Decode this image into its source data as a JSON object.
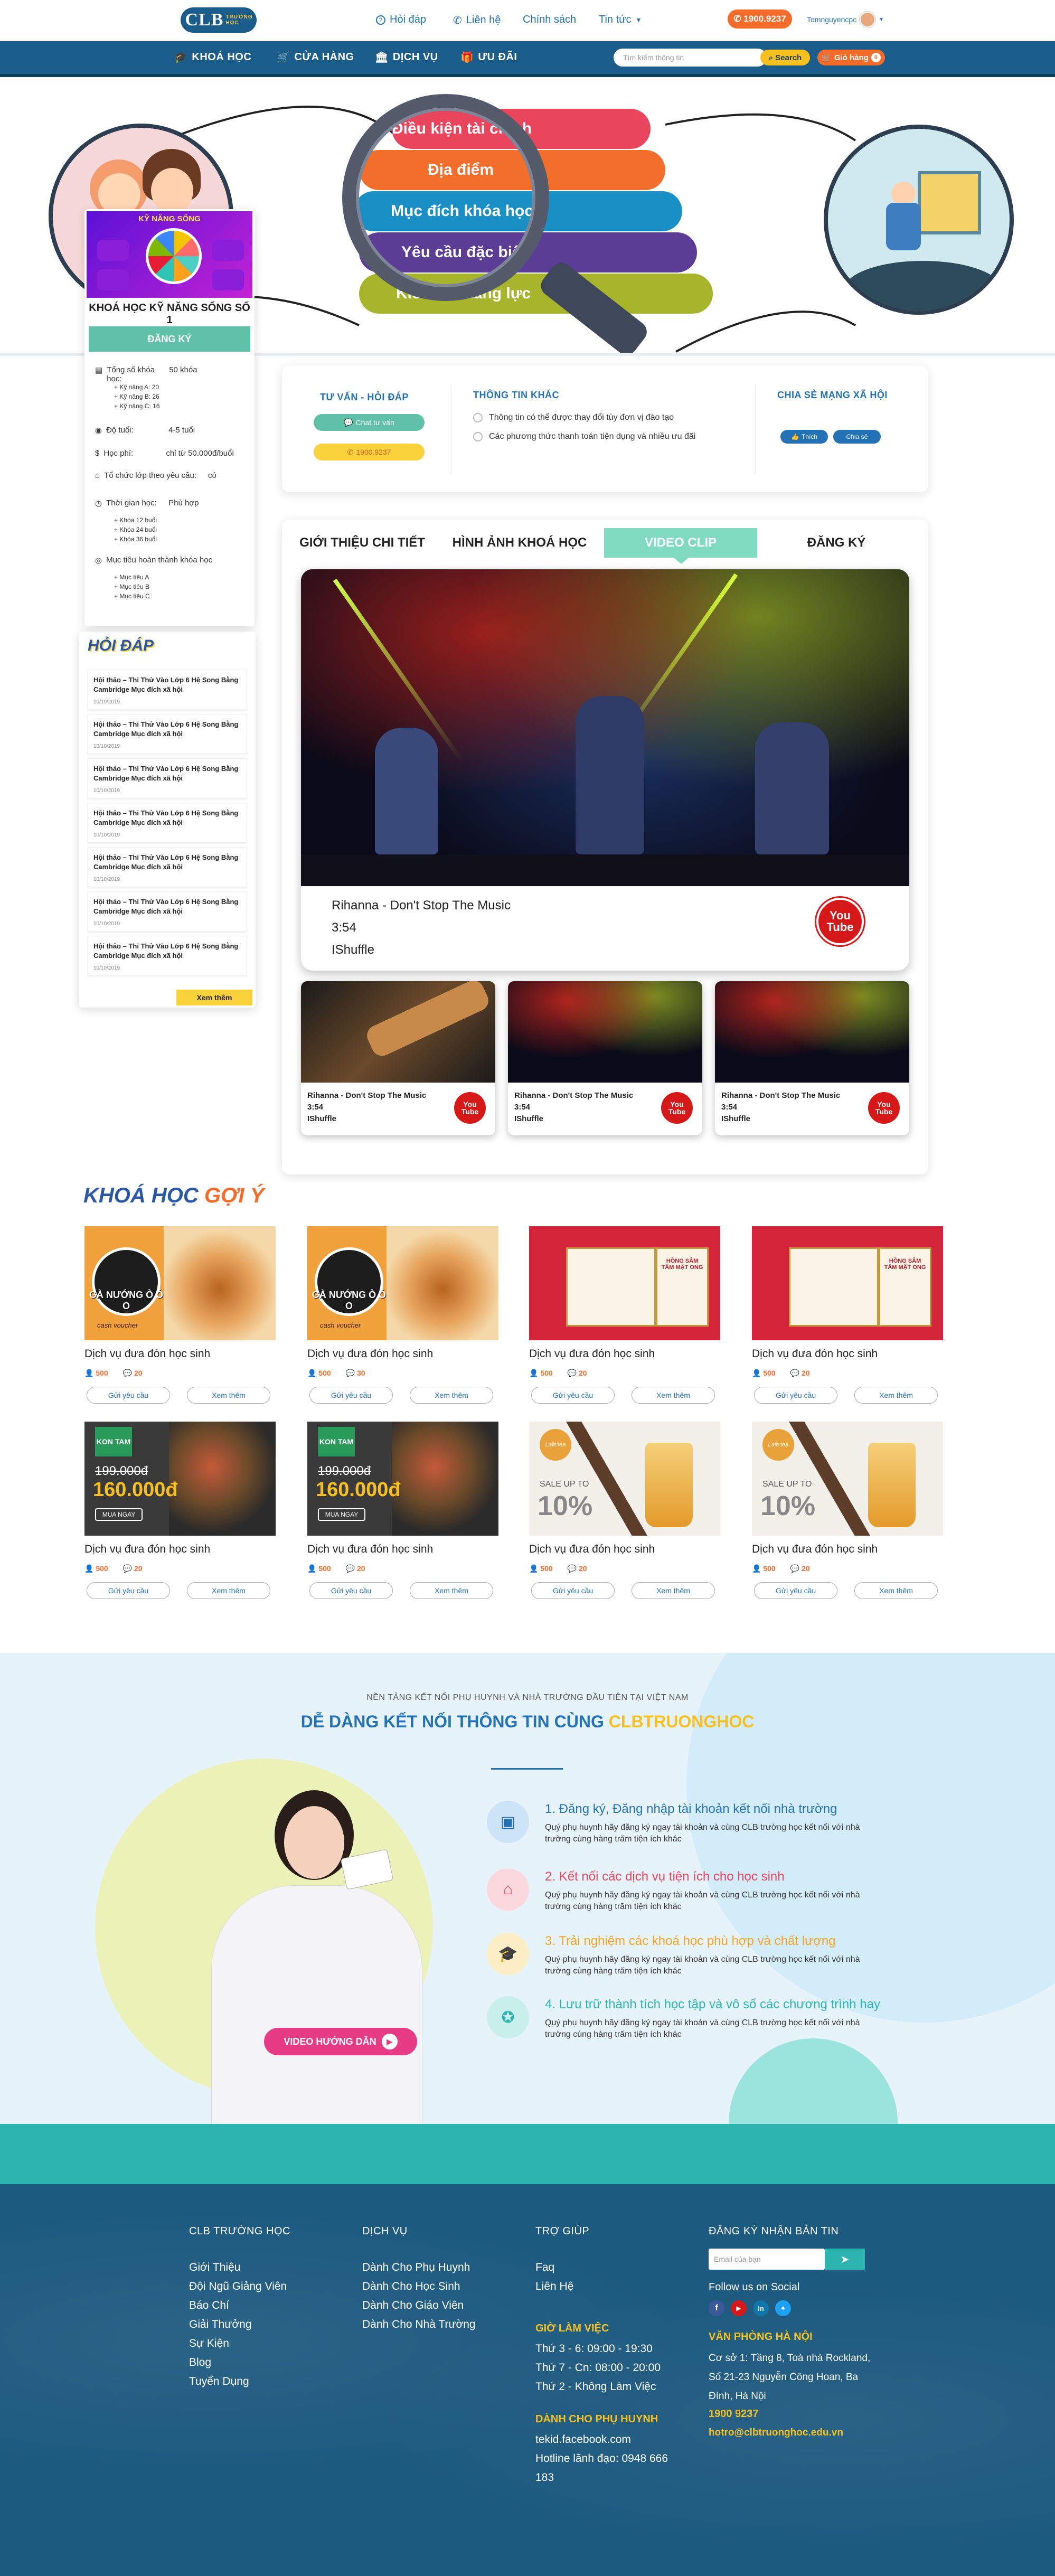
{
  "header": {
    "logo_text": "CLB",
    "logo_sub": "TRƯỜNG HỌC",
    "nav": [
      "Hỏi đáp",
      "Liên hệ",
      "Chính sách",
      "Tin tức"
    ],
    "hotline": "1900.9237",
    "username": "Tomnguyencpc"
  },
  "mainnav": {
    "items": [
      "KHOÁ HỌC",
      "CỬA HÀNG",
      "DỊCH VỤ",
      "ƯU ĐÃI"
    ],
    "search_placeholder": "Tìm kiếm thông tin",
    "search_button": "Search",
    "cart_button": "Giỏ hàng",
    "cart_count": "0"
  },
  "hero": {
    "bands": [
      "Điều kiện tài chính",
      "Địa điểm",
      "Mục đích khóa học",
      "Yêu cầu đặc biệt",
      "Kiểm tra năng lực"
    ],
    "colors": {
      "band1": "#e9455c",
      "band2": "#f36d2b",
      "band3": "#1a8fc6",
      "band4": "#5b3d96",
      "band5": "#a6b52c"
    }
  },
  "course": {
    "image_title": "KỸ NĂNG SỐNG",
    "title": "KHOÁ HỌC KỸ NĂNG SỐNG SỐ 1",
    "register": "ĐĂNG KÝ",
    "total_label": "Tổng số khóa học:",
    "total_value": "50 khóa",
    "total_sub": [
      "+ Kỹ năng A: 20",
      "+ Kỹ năng B: 26",
      "+ Kỹ năng C: 16"
    ],
    "age_label": "Độ tuổi:",
    "age_value": "4-5 tuổi",
    "fee_label": "Học phí:",
    "fee_value": "chỉ từ 50.000đ/buổi",
    "custom_label": "Tổ chức lớp theo yêu cầu:",
    "custom_value": "có",
    "time_label": "Thời gian học:",
    "time_value": "Phù hợp",
    "time_sub": [
      "+ Khóa 12 buổi",
      "+ Khóa 24 buổi",
      "+ Khóa 36 buổi"
    ],
    "goal_label": "Mục tiêu hoàn thành khóa học",
    "goal_sub": [
      "+ Mục tiêu A",
      "+ Mục tiêu B",
      "+ Mục tiêu C"
    ]
  },
  "qa": {
    "title": "HỎI ĐÁP",
    "items": [
      {
        "title": "Hội thảo – Thi Thử Vào Lớp 6 Hệ Song Bằng Cambridge Mục đích xã hội",
        "date": "10/10/2019"
      },
      {
        "title": "Hội thảo – Thi Thử Vào Lớp 6 Hệ Song Bằng Cambridge Mục đích xã hội",
        "date": "10/10/2019"
      },
      {
        "title": "Hội thảo – Thi Thử Vào Lớp 6 Hệ Song Bằng Cambridge Mục đích xã hội",
        "date": "10/10/2019"
      },
      {
        "title": "Hội thảo – Thi Thử Vào Lớp 6 Hệ Song Bằng Cambridge Mục đích xã hội",
        "date": "10/10/2019"
      },
      {
        "title": "Hội thảo – Thi Thử Vào Lớp 6 Hệ Song Bằng Cambridge Mục đích xã hội",
        "date": "10/10/2019"
      },
      {
        "title": "Hội thảo – Thi Thử Vào Lớp 6 Hệ Song Bằng Cambridge Mục đích xã hội",
        "date": "10/10/2019"
      },
      {
        "title": "Hội thảo – Thi Thử Vào Lớp 6 Hệ Song Bằng Cambridge Mục đích xã hội",
        "date": "10/10/2019"
      }
    ],
    "more": "Xem thêm"
  },
  "contact": {
    "advise_title": "TƯ VẤN - HỎI ĐÁP",
    "chat_button": "Chat tư vấn",
    "phone_button": "1900.9237",
    "other_title": "THÔNG TIN KHÁC",
    "other_items": [
      "Thông tin có thể được thay đổi tùy đơn vị đào tạo",
      "Các phương thức thanh toán tiện dụng và nhiều ưu đãi"
    ],
    "share_title": "CHIA SẺ MẠNG XÃ HỘI",
    "like_button": "Thích",
    "share_button": "Chia sẻ"
  },
  "tabs": {
    "items": [
      "GIỚI THIỆU CHI TIẾT",
      "HÌNH ẢNH KHOÁ HỌC",
      "VIDEO CLIP",
      "ĐĂNG KÝ"
    ],
    "active": "VIDEO CLIP"
  },
  "video": {
    "title": "Rihanna - Don't Stop The Music",
    "duration": "3:54",
    "channel": "IShuffle",
    "yt_top": "You",
    "yt_bottom": "Tube",
    "thumbs": [
      {
        "title": "Rihanna - Don't Stop The Music",
        "duration": "3:54",
        "channel": "IShuffle"
      },
      {
        "title": "Rihanna - Don't Stop The Music",
        "duration": "3:54",
        "channel": "IShuffle"
      },
      {
        "title": "Rihanna - Don't Stop The Music",
        "duration": "3:54",
        "channel": "IShuffle"
      }
    ]
  },
  "suggest": {
    "title_a": "KHOÁ HỌC",
    "title_b": "GỢI Ý",
    "cards": [
      {
        "name": "Dịch vụ đưa đón học sinh",
        "views": "500",
        "comments": "20",
        "req": "Gửi yêu cầu",
        "more": "Xem thêm",
        "type": "chicken",
        "brand": "GÀ NƯỚNG Ò Ó O",
        "tag": "cash voucher"
      },
      {
        "name": "Dịch vụ đưa đón học sinh",
        "views": "500",
        "comments": "30",
        "req": "Gửi yêu cầu",
        "more": "Xem thêm",
        "type": "chicken",
        "brand": "GÀ NƯỚNG Ò Ó O",
        "tag": "cash voucher"
      },
      {
        "name": "Dịch vụ đưa đón học sinh",
        "views": "500",
        "comments": "20",
        "req": "Gửi yêu cầu",
        "more": "Xem thêm",
        "type": "ginseng",
        "brand": "HỒNG SÂM TẨM MẬT ONG"
      },
      {
        "name": "Dịch vụ đưa đón học sinh",
        "views": "500",
        "comments": "20",
        "req": "Gửi yêu cầu",
        "more": "Xem thêm",
        "type": "ginseng",
        "brand": "HỒNG SÂM TẨM MẬT ONG"
      },
      {
        "name": "Dịch vụ đưa đón học sinh",
        "views": "500",
        "comments": "20",
        "req": "Gửi yêu cầu",
        "more": "Xem thêm",
        "type": "kontam",
        "brand": "KON TAM",
        "old": "199.000đ",
        "new": "160.000đ",
        "cta": "MUA NGAY"
      },
      {
        "name": "Dịch vụ đưa đón học sinh",
        "views": "500",
        "comments": "20",
        "req": "Gửi yêu cầu",
        "more": "Xem thêm",
        "type": "kontam",
        "brand": "KON TAM",
        "old": "199.000đ",
        "new": "160.000đ",
        "cta": "MUA NGAY"
      },
      {
        "name": "Dịch vụ đưa đón học sinh",
        "views": "500",
        "comments": "20",
        "req": "Gửi yêu cầu",
        "more": "Xem thêm",
        "type": "tea",
        "brand": "Lafe'tea",
        "sale": "SALE UP TO",
        "pct": "10%"
      },
      {
        "name": "Dịch vụ đưa đón học sinh",
        "views": "500",
        "comments": "20",
        "req": "Gửi yêu cầu",
        "more": "Xem thêm",
        "type": "tea",
        "brand": "Lafe'tea",
        "sale": "SALE UP TO",
        "pct": "10%"
      }
    ]
  },
  "connect": {
    "eyebrow": "NỀN TẢNG KẾT NỐI PHỤ HUYNH VÀ NHÀ TRƯỜNG ĐẦU TIÊN TẠI VIỆT NAM",
    "title_a": "DỄ DÀNG KẾT NỐI THÔNG TIN CÙNG ",
    "title_b": "CLBTRUONGHOC",
    "guide_button": "VIDEO HƯỚNG DẪN",
    "steps": [
      {
        "title": "1. Đăng ký, Đăng nhập tài khoản kết nối nhà trường",
        "desc": "Quý phụ huynh hãy đăng ký ngay tài khoản và cùng CLB trường học kết nối với nhà trường cùng hàng trăm tiện ích khác",
        "color": "#2372b6"
      },
      {
        "title": "2. Kết nối các dịch vụ tiện ích cho học sinh",
        "desc": "Quý phụ huynh hãy đăng ký ngay tài khoản và cùng CLB trường học kết nối với nhà trường cùng hàng trăm tiện ích khác",
        "color": "#e9455c"
      },
      {
        "title": "3. Trải nghiệm các khoá học phù hợp và chất lượng",
        "desc": "Quý phụ huynh hãy đăng ký ngay tài khoản và cùng CLB trường học kết nối với nhà trường cùng hàng trăm tiện ích khác",
        "color": "#f5a31f"
      },
      {
        "title": "4. Lưu trữ thành tích học tập và vô số các chương trình hay",
        "desc": "Quý phụ huynh hãy đăng ký ngay tài khoản và cùng CLB trường học kết nối với nhà trường cùng hàng trăm tiện ích khác",
        "color": "#2cb5b0"
      }
    ]
  },
  "footer": {
    "col1_title": "CLB TRƯỜNG HỌC",
    "col1": [
      "Giới Thiệu",
      "Đội Ngũ Giảng Viên",
      "Báo Chí",
      "Giải Thưởng",
      "Sự Kiện",
      "Blog",
      "Tuyển Dụng"
    ],
    "col2_title": "DỊCH VỤ",
    "col2": [
      "Dành Cho Phụ Huynh",
      "Dành Cho Học Sinh",
      "Dành Cho Giáo Viên",
      "Dành Cho Nhà Trường"
    ],
    "col3_title": "TRỢ GIÚP",
    "col3": [
      "Faq",
      "Liên Hệ"
    ],
    "hours_title": "GIỜ LÀM VIỆC",
    "hours": [
      "Thứ 3 - 6: 09:00 - 19:30",
      "Thứ 7 - Cn: 08:00 - 20:00",
      "Thứ 2 - Không Làm Việc"
    ],
    "parents_title": "DÀNH CHO PHỤ HUYNH",
    "parents": [
      "tekid.facebook.com",
      "Hotline lãnh đạo: 0948 666",
      "183"
    ],
    "news_title": "ĐĂNG KÝ NHẬN BẢN TIN",
    "email_placeholder": "Email của bạn",
    "follow": "Follow us on Social",
    "office_title": "VĂN PHÒNG HÀ NỘI",
    "office": [
      "Cơ sở 1: Tầng 8, Toà nhà Rockland,",
      "Số 21-23 Nguyễn Công Hoan, Ba",
      "Đình, Hà Nội"
    ],
    "phone": "1900 9237",
    "email": "hotro@clbtruonghoc.edu.vn"
  }
}
